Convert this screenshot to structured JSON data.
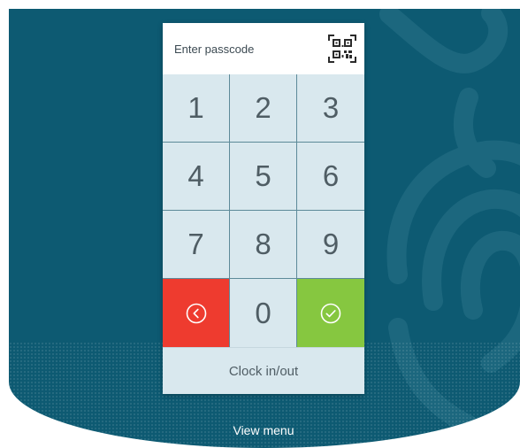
{
  "passcode": {
    "placeholder": "Enter passcode",
    "value": ""
  },
  "qr_button": {
    "icon": "qr-code-icon"
  },
  "keypad": {
    "rows": [
      [
        "1",
        "2",
        "3"
      ],
      [
        "4",
        "5",
        "6"
      ],
      [
        "7",
        "8",
        "9"
      ]
    ],
    "zero": "0",
    "back_icon": "chevron-left-circle-icon",
    "confirm_icon": "check-circle-icon"
  },
  "clock_button": {
    "label": "Clock in/out"
  },
  "footer": {
    "view_menu": "View menu"
  },
  "colors": {
    "background": "#0d5a72",
    "keypad": "#d9e8ee",
    "back": "#ee3b2f",
    "confirm": "#86c740"
  }
}
